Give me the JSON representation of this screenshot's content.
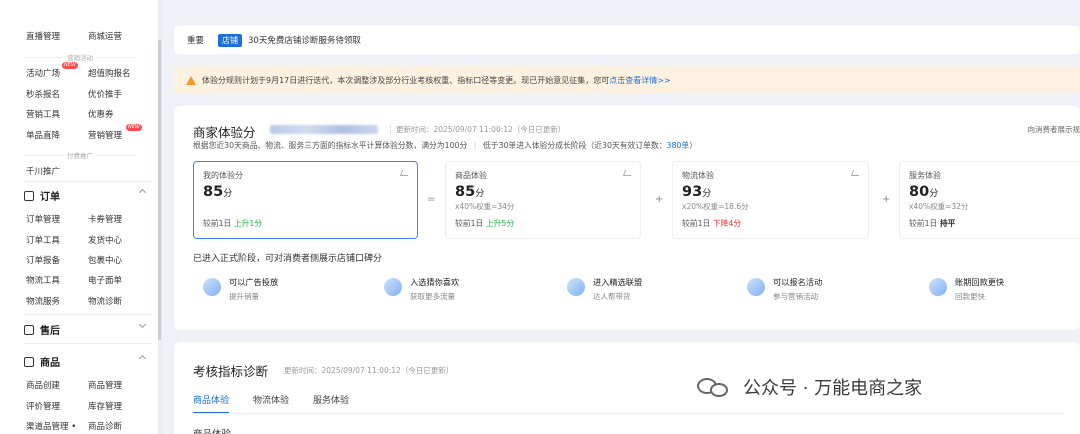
{
  "sidebar": {
    "rows": [
      [
        "直播管理",
        "商城运营"
      ],
      [
        "活动广场",
        "超值购报名"
      ],
      [
        "秒杀报名",
        "优价推手"
      ],
      [
        "营销工具",
        "优惠券"
      ],
      [
        "单品直降",
        "营销管理"
      ]
    ],
    "group_marketing": "营销活动",
    "hot_badge": "NEW",
    "group_ads": "付费推广",
    "qianchuan": "千川推广",
    "order_section": "订单",
    "order_rows": [
      [
        "订单管理",
        "卡券管理"
      ],
      [
        "订单工具",
        "发货中心"
      ],
      [
        "订单报备",
        "包裹中心"
      ],
      [
        "物流工具",
        "电子面单"
      ],
      [
        "物流服务",
        "物流诊断"
      ]
    ],
    "aftersale_section": "售后",
    "product_section": "商品",
    "product_rows": [
      [
        "商品创建",
        "商品管理"
      ],
      [
        "评价管理",
        "库存管理"
      ],
      [
        "渠道品管理 •",
        "商品诊断"
      ]
    ]
  },
  "notice": {
    "label": "重要",
    "tag": "店铺",
    "text": "30天免费店铺诊断服务待领取"
  },
  "warning": {
    "text": "体验分规则计划于9月17日进行迭代，本次调整涉及部分行业考核权重、指标口径等变更。现已开始意见征集，您可",
    "link": "点击查看详情>>"
  },
  "score_card": {
    "title": "商家体验分",
    "update_time": "更新时间：2025/09/07 11:00:12（今日已更新）",
    "right_link": "向消费者展示规",
    "desc_prefix": "根据您近30天商品、物流、服务三方面的指标水平计算体验分数，满分为100分",
    "desc_mid": "低于30单进入体验分成长阶段（近30天有效订单数：",
    "desc_num": "380单",
    "desc_suffix": "）",
    "metrics": [
      {
        "label": "我的体验分",
        "value": "85",
        "unit": "分",
        "weight": "",
        "compare": "较前1日",
        "delta": "上升1分",
        "trend": "up"
      },
      {
        "label": "商品体验",
        "value": "85",
        "unit": "分",
        "weight": "x40%权重=34分",
        "compare": "较前1日",
        "delta": "上升5分",
        "trend": "up"
      },
      {
        "label": "物流体验",
        "value": "93",
        "unit": "分",
        "weight": "x20%权重=18.6分",
        "compare": "较前1日",
        "delta": "下降4分",
        "trend": "down"
      },
      {
        "label": "服务体验",
        "value": "80",
        "unit": "分",
        "weight": "x40%权重=32分",
        "compare": "较前1日",
        "delta": "持平",
        "trend": "flat"
      }
    ],
    "ops": [
      "=",
      "+",
      "+"
    ],
    "stage": "已进入正式阶段，可对消费者侧展示店铺口碑分",
    "perks": [
      {
        "title": "可以广告投放",
        "sub": "提升销量"
      },
      {
        "title": "入选猜你喜欢",
        "sub": "获取更多流量"
      },
      {
        "title": "进入精选联盟",
        "sub": "达人帮带货"
      },
      {
        "title": "可以报名活动",
        "sub": "参与营销活动"
      },
      {
        "title": "账期回款更快",
        "sub": "回款更快"
      }
    ]
  },
  "diagnosis": {
    "title": "考核指标诊断",
    "update_time": "更新时间：2025/09/07 11:00:12（今日已更新）",
    "tabs": [
      "商品体验",
      "物流体验",
      "服务体验"
    ],
    "sub_title": "商品体验"
  },
  "watermark": "公众号 · 万能电商之家"
}
